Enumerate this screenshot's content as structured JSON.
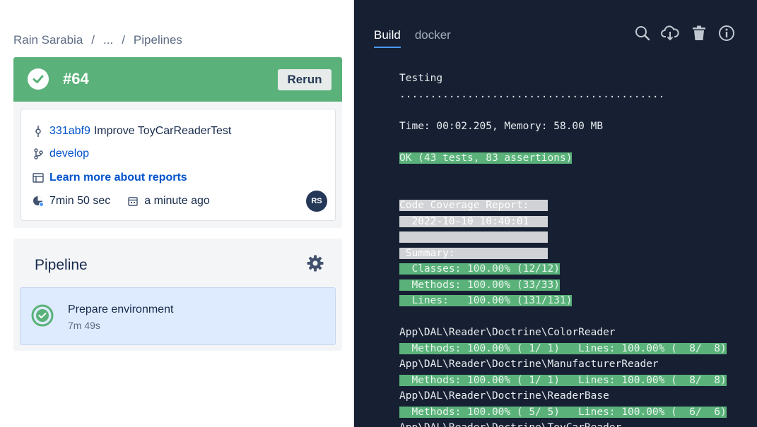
{
  "breadcrumb": {
    "workspace": "Rain Sarabia",
    "ellipsis": "...",
    "current": "Pipelines",
    "separator": "/"
  },
  "build": {
    "number": "#64",
    "rerun_label": "Rerun",
    "status_color": "#5ab27a",
    "commit_hash": "331abf9",
    "commit_message": "Improve ToyCarReaderTest",
    "branch": "develop",
    "reports_link": "Learn more about reports",
    "duration": "7min 50 sec",
    "started": "a minute ago",
    "avatar_initials": "RS"
  },
  "pipeline": {
    "title": "Pipeline",
    "steps": [
      {
        "name": "Prepare environment",
        "duration": "7m 49s"
      }
    ]
  },
  "log_panel": {
    "tabs": [
      {
        "label": "Build"
      },
      {
        "label": "docker"
      }
    ],
    "icons": [
      "search-icon",
      "cloud-download-icon",
      "trash-icon",
      "info-icon"
    ],
    "lines": [
      {
        "text": "Testing",
        "hl": ""
      },
      {
        "text": "...........................................",
        "hl": ""
      },
      {
        "text": "",
        "hl": ""
      },
      {
        "text": "Time: 00:02.205, Memory: 58.00 MB",
        "hl": ""
      },
      {
        "text": "",
        "hl": ""
      },
      {
        "text": "OK (43 tests, 83 assertions)",
        "hl": "green"
      },
      {
        "text": "",
        "hl": ""
      },
      {
        "text": "",
        "hl": ""
      },
      {
        "text": "Code Coverage Report:   ",
        "hl": "gray"
      },
      {
        "text": "  2022-10-10 10:40:01   ",
        "hl": "gray"
      },
      {
        "text": "                        ",
        "hl": "gray"
      },
      {
        "text": " Summary:               ",
        "hl": "gray"
      },
      {
        "text": "  Classes: 100.00% (12/12)",
        "hl": "green"
      },
      {
        "text": "  Methods: 100.00% (33/33)",
        "hl": "green"
      },
      {
        "text": "  Lines:   100.00% (131/131)",
        "hl": "green"
      },
      {
        "text": "",
        "hl": ""
      },
      {
        "text": "App\\DAL\\Reader\\Doctrine\\ColorReader",
        "hl": ""
      },
      {
        "text": "  Methods: 100.00% ( 1/ 1)   Lines: 100.00% (  8/  8)",
        "hl": "green"
      },
      {
        "text": "App\\DAL\\Reader\\Doctrine\\ManufacturerReader",
        "hl": ""
      },
      {
        "text": "  Methods: 100.00% ( 1/ 1)   Lines: 100.00% (  8/  8)",
        "hl": "green"
      },
      {
        "text": "App\\DAL\\Reader\\Doctrine\\ReaderBase",
        "hl": ""
      },
      {
        "text": "  Methods: 100.00% ( 5/ 5)   Lines: 100.00% (  6/  6)",
        "hl": "green"
      },
      {
        "text": "App\\DAL\\Reader\\Doctrine\\ToyCarReader",
        "hl": ""
      }
    ]
  }
}
